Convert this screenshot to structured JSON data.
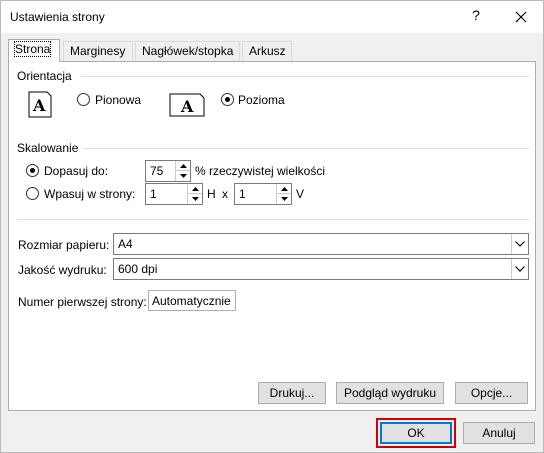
{
  "window": {
    "title": "Ustawienia strony",
    "help": "?",
    "close": "✕"
  },
  "tabs": [
    {
      "label": "Strona",
      "active": true
    },
    {
      "label": "Marginesy",
      "active": false
    },
    {
      "label": "Nagłówek/stopka",
      "active": false
    },
    {
      "label": "Arkusz",
      "active": false
    }
  ],
  "orientation": {
    "title": "Orientacja",
    "portrait_label": "Pionowa",
    "landscape_label": "Pozioma",
    "selected": "landscape",
    "icon_letter": "A"
  },
  "scaling": {
    "title": "Skalowanie",
    "adjust_label": "Dopasuj do:",
    "adjust_value": "75",
    "adjust_suffix": "% rzeczywistej wielkości",
    "fit_label": "Wpasuj w strony:",
    "fit_width": "1",
    "fit_w_label": "H",
    "fit_x": "x",
    "fit_height": "1",
    "fit_h_label": "V",
    "selected": "adjust"
  },
  "paper": {
    "size_label": "Rozmiar papieru:",
    "size_value": "A4",
    "quality_label": "Jakość wydruku:",
    "quality_value": "600 dpi",
    "first_page_label": "Numer pierwszej strony:",
    "first_page_value": "Automatycznie"
  },
  "buttons": {
    "print": "Drukuj...",
    "preview": "Podgląd wydruku",
    "options": "Opcje...",
    "ok": "OK",
    "cancel": "Anuluj"
  }
}
